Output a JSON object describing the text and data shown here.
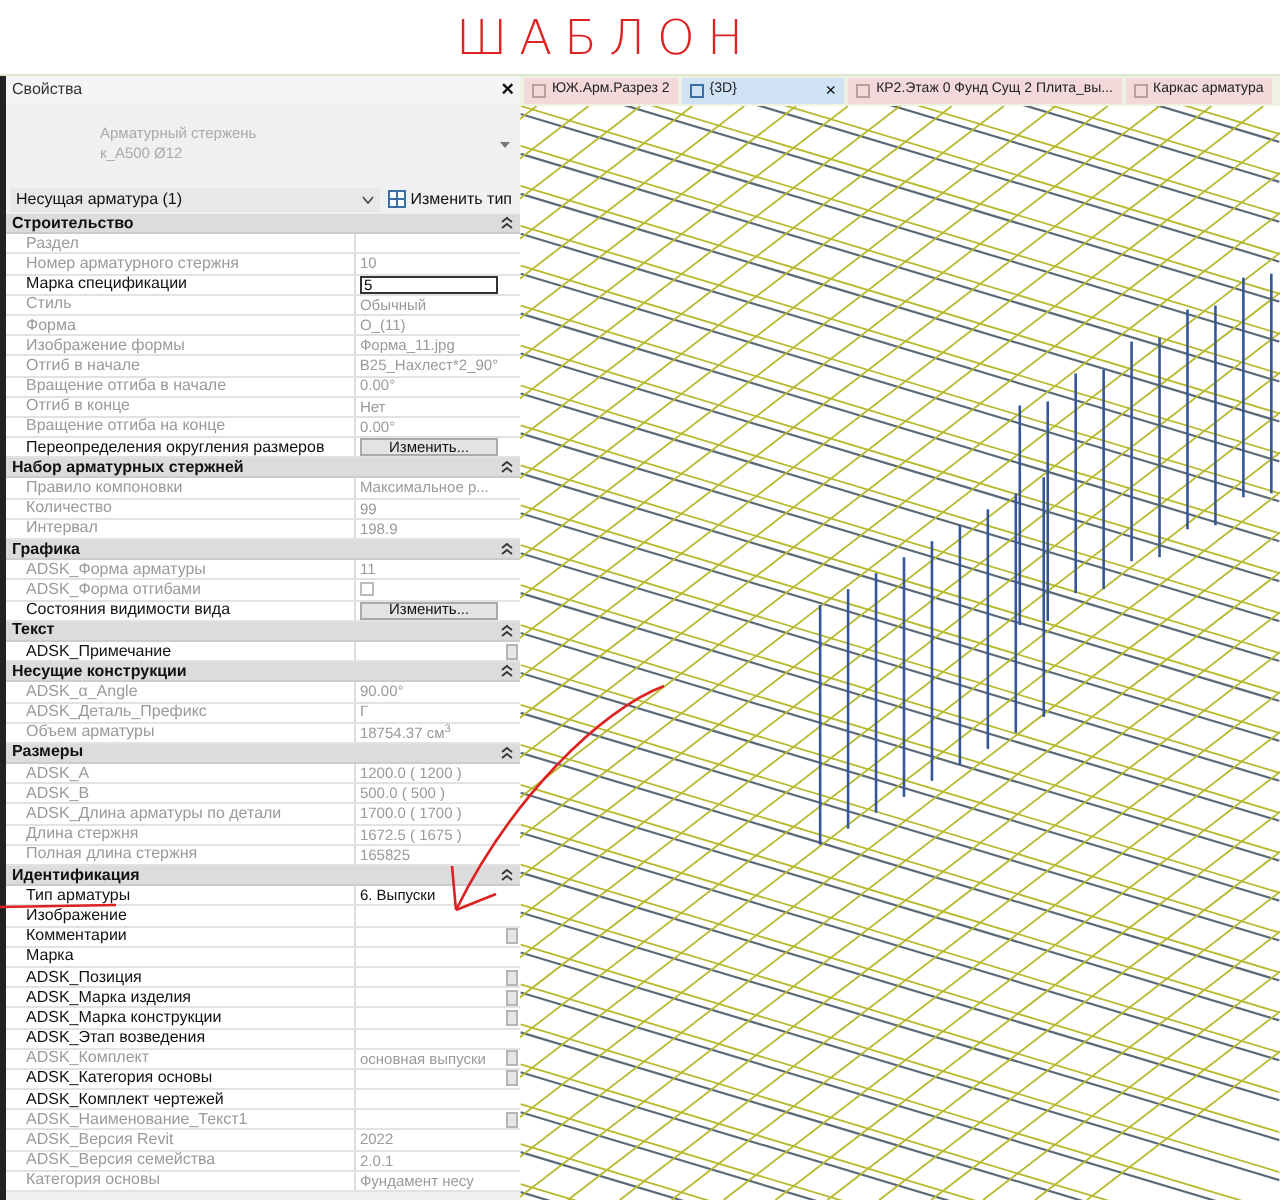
{
  "annotation": {
    "text": "ШАБЛОН"
  },
  "properties": {
    "title": "Свойства",
    "close": "×",
    "type_lines": [
      "Арматурный стержень",
      "к_А500 Ø12"
    ],
    "filter": "Несущая арматура (1)",
    "edit_type": "Изменить тип",
    "groups": [
      {
        "title": "Строительство",
        "expanded": true,
        "rows": [
          {
            "label": "Раздел",
            "kind": "text",
            "editable": false
          },
          {
            "label": "Номер арматурного стержня",
            "value": "10",
            "kind": "text",
            "editable": false
          },
          {
            "label": "Марка спецификации",
            "value": "5",
            "kind": "field",
            "editable": true
          },
          {
            "label": "Стиль",
            "value": "Обычный",
            "kind": "text",
            "editable": false
          },
          {
            "label": "Форма",
            "value": "О_(11)",
            "kind": "text",
            "editable": false
          },
          {
            "label": "Изображение формы",
            "value": "Форма_11.jpg",
            "kind": "text",
            "editable": false
          },
          {
            "label": "Отгиб в начале",
            "value": "В25_Нахлест*2_90°",
            "kind": "text",
            "editable": false
          },
          {
            "label": "Вращение отгиба в начале",
            "value": "0.00°",
            "kind": "text",
            "editable": false
          },
          {
            "label": "Отгиб в конце",
            "value": "Нет",
            "kind": "text",
            "editable": false
          },
          {
            "label": "Вращение отгиба на конце",
            "value": "0.00°",
            "kind": "text",
            "editable": false
          },
          {
            "label": "Переопределения округления размеров",
            "value": "Изменить...",
            "kind": "button",
            "editable": true
          }
        ]
      },
      {
        "title": "Набор арматурных стержней",
        "expanded": true,
        "rows": [
          {
            "label": "Правило компоновки",
            "value": "Максимальное р...",
            "kind": "text",
            "editable": false
          },
          {
            "label": "Количество",
            "value": "99",
            "kind": "text",
            "editable": false
          },
          {
            "label": "Интервал",
            "value": "198.9",
            "kind": "text",
            "editable": false
          }
        ]
      },
      {
        "title": "Графика",
        "expanded": true,
        "rows": [
          {
            "label": "ADSK_Форма арматуры",
            "value": "11",
            "kind": "text",
            "editable": false
          },
          {
            "label": "ADSK_Форма отгибами",
            "kind": "checkbox",
            "checked": false,
            "editable": false
          },
          {
            "label": "Состояния видимости вида",
            "value": "Изменить...",
            "kind": "button",
            "editable": true
          }
        ]
      },
      {
        "title": "Текст",
        "expanded": true,
        "rows": [
          {
            "label": "ADSK_Примечание",
            "kind": "browse",
            "editable": true
          }
        ]
      },
      {
        "title": "Несущие конструкции",
        "expanded": true,
        "rows": [
          {
            "label": "ADSK_α_Angle",
            "value": "90.00°",
            "kind": "text",
            "editable": false
          },
          {
            "label": "ADSK_Деталь_Префикс",
            "value": "Г",
            "kind": "text",
            "editable": false
          },
          {
            "label": "Объем арматуры",
            "value": "18754.37 см$^{3}$",
            "kind": "text",
            "editable": false
          }
        ]
      },
      {
        "title": "Размеры",
        "expanded": true,
        "rows": [
          {
            "label": "ADSK_A",
            "value": "1200.0 ( 1200 )",
            "kind": "text",
            "editable": false
          },
          {
            "label": "ADSK_B",
            "value": "500.0 ( 500 )",
            "kind": "text",
            "editable": false
          },
          {
            "label": "ADSK_Длина арматуры по детали",
            "value": "1700.0 ( 1700 )",
            "kind": "text",
            "editable": false
          },
          {
            "label": "Длина стержня",
            "value": "1672.5 ( 1675 )",
            "kind": "text",
            "editable": false
          },
          {
            "label": "Полная длина стержня",
            "value": "165825",
            "kind": "text",
            "editable": false
          }
        ]
      },
      {
        "title": "Идентификация",
        "expanded": true,
        "rows": [
          {
            "label": "Тип арматуры",
            "value": "6. Выпуски",
            "kind": "text",
            "editable": true
          },
          {
            "label": "Изображение",
            "kind": "text",
            "editable": true
          },
          {
            "label": "Комментарии",
            "kind": "browse",
            "editable": true
          },
          {
            "label": "Марка",
            "kind": "text",
            "editable": true
          },
          {
            "label": "ADSK_Позиция",
            "kind": "browse",
            "editable": true
          },
          {
            "label": "ADSK_Марка изделия",
            "kind": "browse",
            "editable": true
          },
          {
            "label": "ADSK_Марка конструкции",
            "kind": "browse",
            "editable": true
          },
          {
            "label": "ADSK_Этап возведения",
            "kind": "text",
            "editable": true
          },
          {
            "label": "ADSK_Комплект",
            "value": "основная выпуски",
            "kind": "browse",
            "editable": false
          },
          {
            "label": "ADSK_Категория основы",
            "kind": "browse",
            "editable": true
          },
          {
            "label": "ADSK_Комплект чертежей",
            "kind": "text",
            "editable": true
          },
          {
            "label": "ADSK_Наименование_Текст1",
            "kind": "browse",
            "editable": false
          },
          {
            "label": "ADSK_Версия Revit",
            "value": "2022",
            "kind": "text",
            "editable": false
          },
          {
            "label": "ADSK_Версия семейства",
            "value": "2.0.1",
            "kind": "text",
            "editable": false
          },
          {
            "label": "Категория основы",
            "value": "Фундамент несу",
            "kind": "text",
            "editable": false
          }
        ]
      }
    ]
  },
  "tabs": [
    {
      "label": "ЮЖ.Арм.Разрез 2",
      "selected": false
    },
    {
      "label": "{3D}",
      "selected": true,
      "close": "×"
    },
    {
      "label": "КР2.Этаж 0 Фунд Сущ 2 Плита_вы...",
      "selected": false
    },
    {
      "label": "Каркас арматура",
      "selected": false
    }
  ]
}
